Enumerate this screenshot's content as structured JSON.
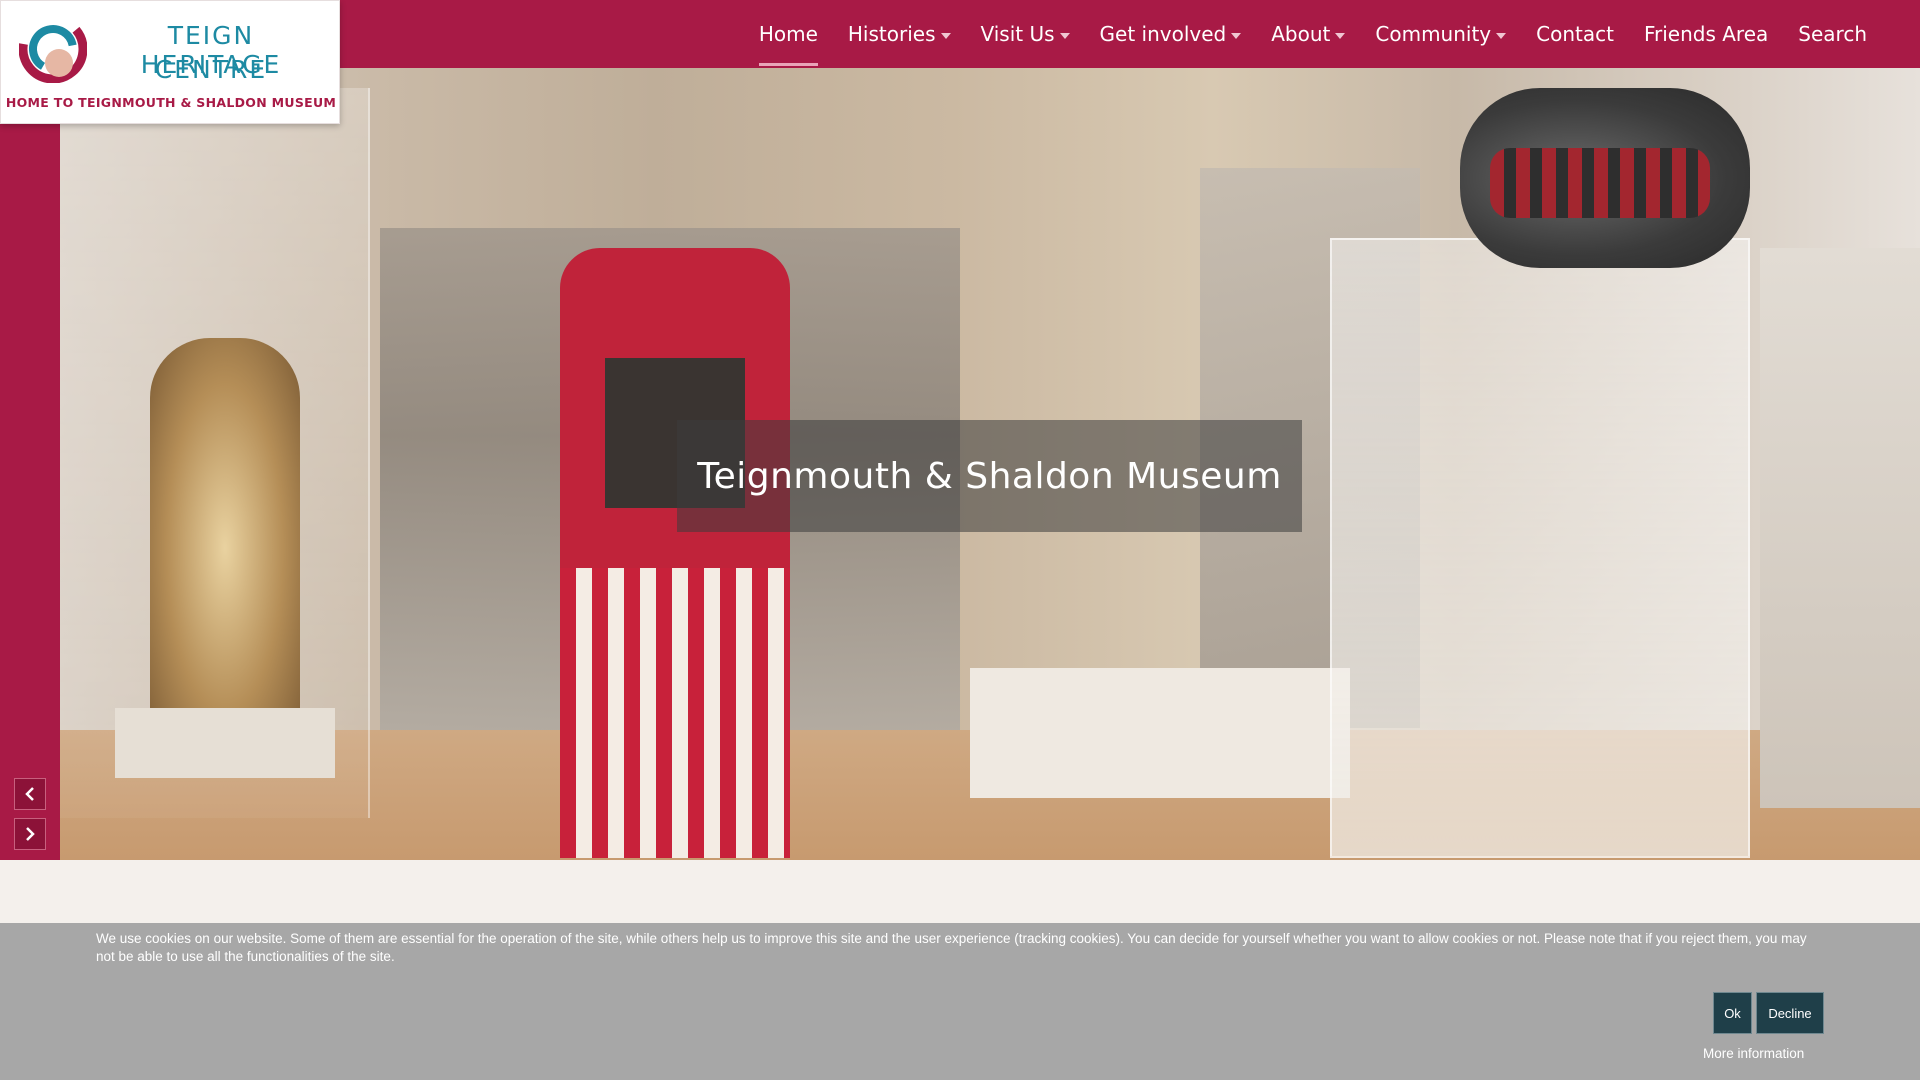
{
  "logo": {
    "line1": "TEIGN HERITAGE",
    "line2": "CENTRE",
    "tagline": "HOME TO TEIGNMOUTH & SHALDON MUSEUM"
  },
  "nav": {
    "items": [
      {
        "label": "Home",
        "dropdown": false,
        "active": true
      },
      {
        "label": "Histories",
        "dropdown": true,
        "active": false
      },
      {
        "label": "Visit Us",
        "dropdown": true,
        "active": false
      },
      {
        "label": "Get involved",
        "dropdown": true,
        "active": false
      },
      {
        "label": "About",
        "dropdown": true,
        "active": false
      },
      {
        "label": "Community",
        "dropdown": true,
        "active": false
      },
      {
        "label": "Contact",
        "dropdown": false,
        "active": false
      },
      {
        "label": "Friends Area",
        "dropdown": false,
        "active": false
      },
      {
        "label": "Search",
        "dropdown": false,
        "active": false
      }
    ]
  },
  "hero": {
    "caption": "Teignmouth & Shaldon Museum",
    "slide_count": 3,
    "active_slide": 1
  },
  "cookie": {
    "text": "We use cookies on our website. Some of them are essential for the operation of the site, while others help us to improve this site and the user experience (tracking cookies). You can decide for yourself whether you want to allow cookies or not. Please note that if you reject them, you may not be able to use all the functionalities of the site.",
    "ok_label": "Ok",
    "decline_label": "Decline",
    "more_label": "More information"
  },
  "colors": {
    "brand_crimson": "#a81a46",
    "brand_teal": "#1d8aa3",
    "cookie_bg": "#a7a7a7",
    "cookie_button": "#1f3f49"
  },
  "icons": {
    "prev": "chevron-left-icon",
    "next": "chevron-right-icon",
    "dropdown": "caret-down-icon"
  }
}
